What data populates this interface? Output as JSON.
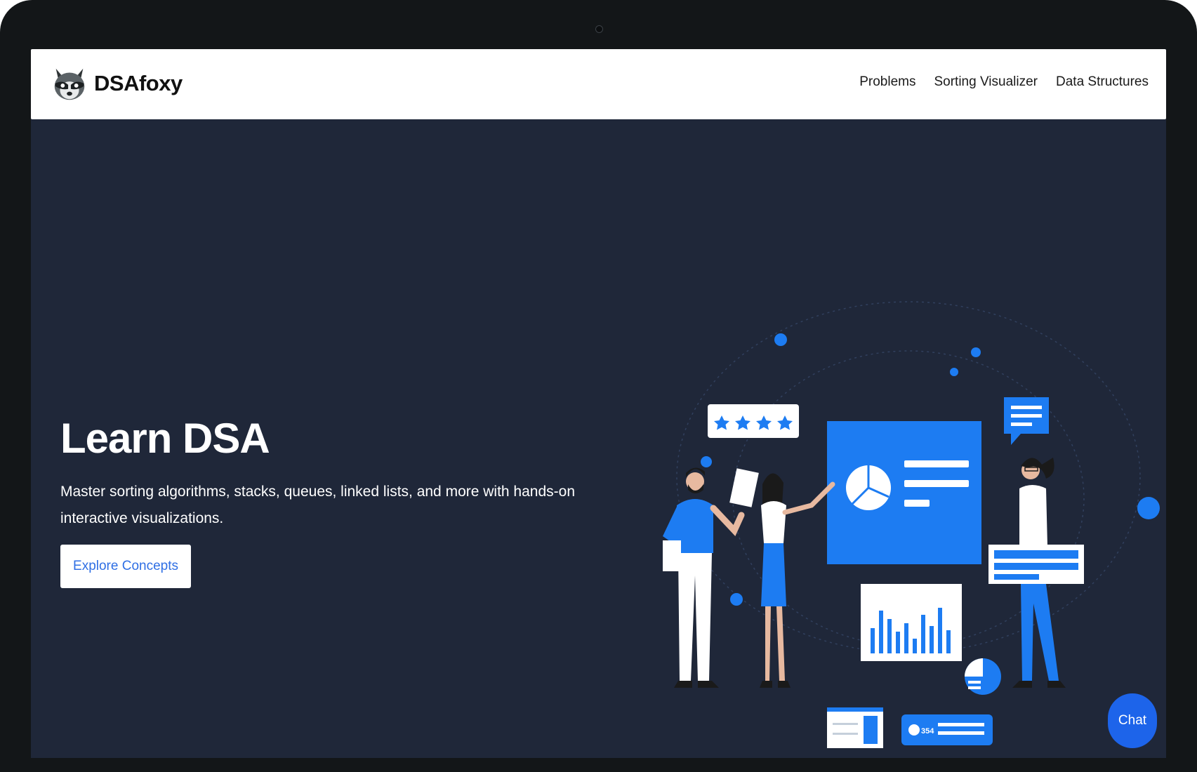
{
  "brand": {
    "name": "DSAfoxy",
    "logo_icon": "raccoon-logo-icon"
  },
  "nav": {
    "items": [
      {
        "label": "Problems"
      },
      {
        "label": "Sorting Visualizer"
      },
      {
        "label": "Data Structures"
      }
    ]
  },
  "hero": {
    "title": "Learn DSA",
    "description": "Master sorting algorithms, stacks, queues, linked lists, and more with hands-on interactive visualizations.",
    "cta_label": "Explore Concepts"
  },
  "illustration": {
    "badge_value": "354",
    "rating_stars": 4
  },
  "chat": {
    "label": "Chat"
  },
  "colors": {
    "background": "#1f2739",
    "accent": "#1d7cf2",
    "button_text": "#2f6fe4",
    "chat": "#1d64ea"
  }
}
